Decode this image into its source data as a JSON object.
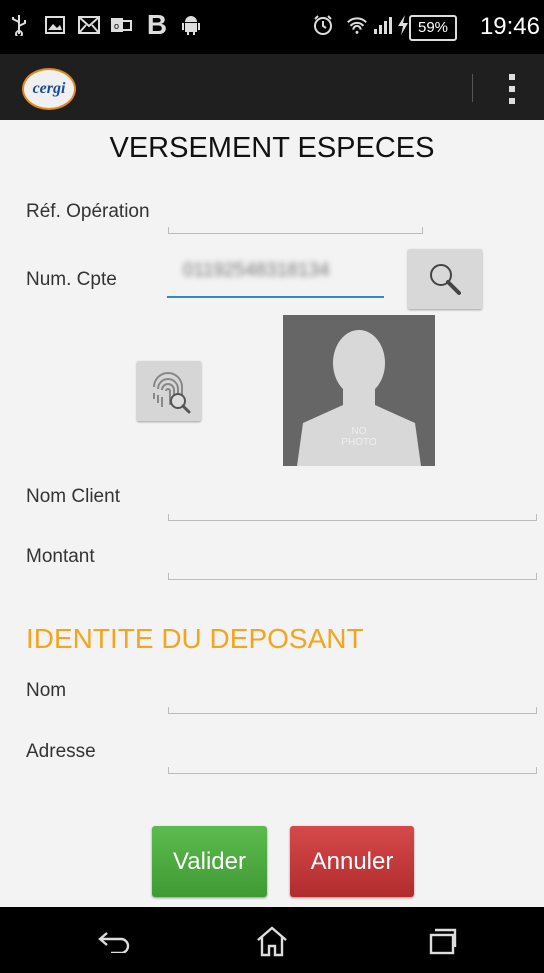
{
  "status_bar": {
    "time": "19:46",
    "battery": "59%",
    "icons": [
      "usb-icon",
      "image-icon",
      "mail-icon",
      "outlook-icon",
      "b-app-icon",
      "android-icon",
      "alarm-icon",
      "wifi-icon",
      "signal-icon",
      "charging-icon"
    ]
  },
  "action_bar": {
    "logo_text": "cergi",
    "menu_icon": "overflow-menu-icon"
  },
  "page": {
    "title": "VERSEMENT ESPECES"
  },
  "form": {
    "ref_operation": {
      "label": "Réf. Opération",
      "value": ""
    },
    "num_cpte": {
      "label": "Num. Cpte",
      "value": "01192548318134"
    },
    "photo": {
      "line1": "NO",
      "line2": "PHOTO"
    },
    "nom_client": {
      "label": "Nom Client",
      "value": ""
    },
    "montant": {
      "label": "Montant",
      "value": ""
    }
  },
  "depositor": {
    "section_title": "IDENTITE DU DEPOSANT",
    "nom": {
      "label": "Nom",
      "value": ""
    },
    "adresse": {
      "label": "Adresse",
      "value": ""
    }
  },
  "actions": {
    "valider": "Valider",
    "annuler": "Annuler"
  },
  "colors": {
    "accent_orange": "#f4a51c",
    "focus_blue": "#2d8ac6",
    "valider_green": "#4caf3f",
    "annuler_red": "#c33a3b"
  },
  "nav_bar": {
    "icons": [
      "back-icon",
      "home-icon",
      "recents-icon"
    ]
  }
}
